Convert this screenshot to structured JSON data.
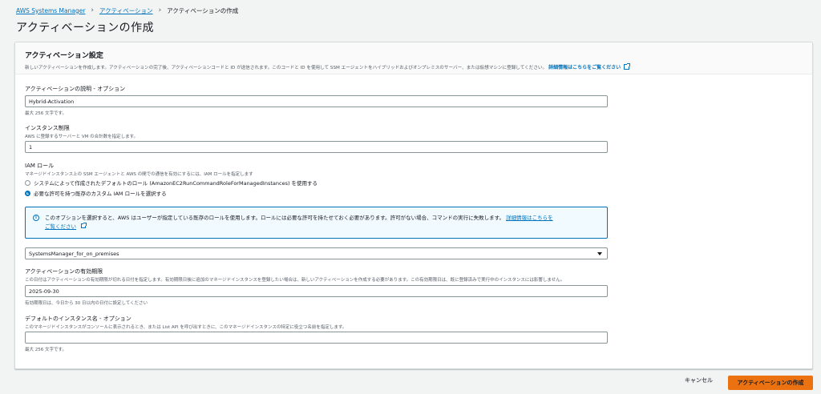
{
  "breadcrumb": {
    "items": [
      "AWS Systems Manager",
      "アクティベーション"
    ],
    "current": "アクティベーションの作成"
  },
  "page_title": "アクティベーションの作成",
  "panel": {
    "title": "アクティベーション設定",
    "description": "新しいアクティベーションを作成します。アクティベーションの完了後、アクティベーションコードと ID が送信されます。このコードと ID を使用して SSM エージェントをハイブリッドおよびオンプレミスのサーバー、または仮想マシンに登録してください。",
    "info_link": "詳細情報はこちらをご覧ください"
  },
  "description_field": {
    "label": "アクティベーションの説明 - オプション",
    "value": "Hybrid-Activation",
    "hint": "最大 256 文字です。"
  },
  "instance_limit": {
    "label": "インスタンス制限",
    "description": "AWS に登録するサーバーと VM の合計数を指定します。",
    "value": "1"
  },
  "iam_role": {
    "label": "IAM ロール",
    "description": "マネージドインスタンス上の SSM エージェントと AWS の間での通信を有効にするには、IAM ロールを指定します",
    "options": [
      {
        "label": "システムによって作成されたデフォルトのロール (AmazonEC2RunCommandRoleForManagedInstances) を使用する",
        "checked": false
      },
      {
        "label": "必要な許可を持つ既存のカスタム IAM ロールを選択する",
        "checked": true
      }
    ],
    "alert_text": "このオプションを選択すると、AWS はユーザーが指定している既存のロールを使用します。ロールには必要な許可を持たせておく必要があります。許可がない場合、コマンドの実行に失敗します。",
    "alert_link_1": "詳細情報はこちらを",
    "alert_link_2": "ご覧ください",
    "selected_role": "SystemsManager_for_on_premises"
  },
  "expiration": {
    "label": "アクティベーションの有効期限",
    "description": "この日付はアクティベーションの有効期限が切れる日付を指定します。有効期限日後に追加のマネージドインスタンスを登録したい場合は、新しいアクティベーションを作成する必要があります。この有効期限日は、既に登録済みで実行中のインスタンスには影響しません。",
    "value": "2025-09-30",
    "hint": "有効期限日は、今日から 30 日以内の日付に設定してください"
  },
  "default_name": {
    "label": "デフォルトのインスタンス名 - オプション",
    "description": "このマネージドインスタンスがコンソールに表示されるとき、または List API を呼び出すときに、このマネージドインスタンスの特定に役立つ名前を指定します。",
    "value": "",
    "hint": "最大 256 文字です。"
  },
  "footer": {
    "cancel": "キャンセル",
    "create": "アクティベーションの作成"
  },
  "colors": {
    "link": "#0073bb",
    "primary_button": "#ec7211",
    "background": "#f2f3f3"
  }
}
